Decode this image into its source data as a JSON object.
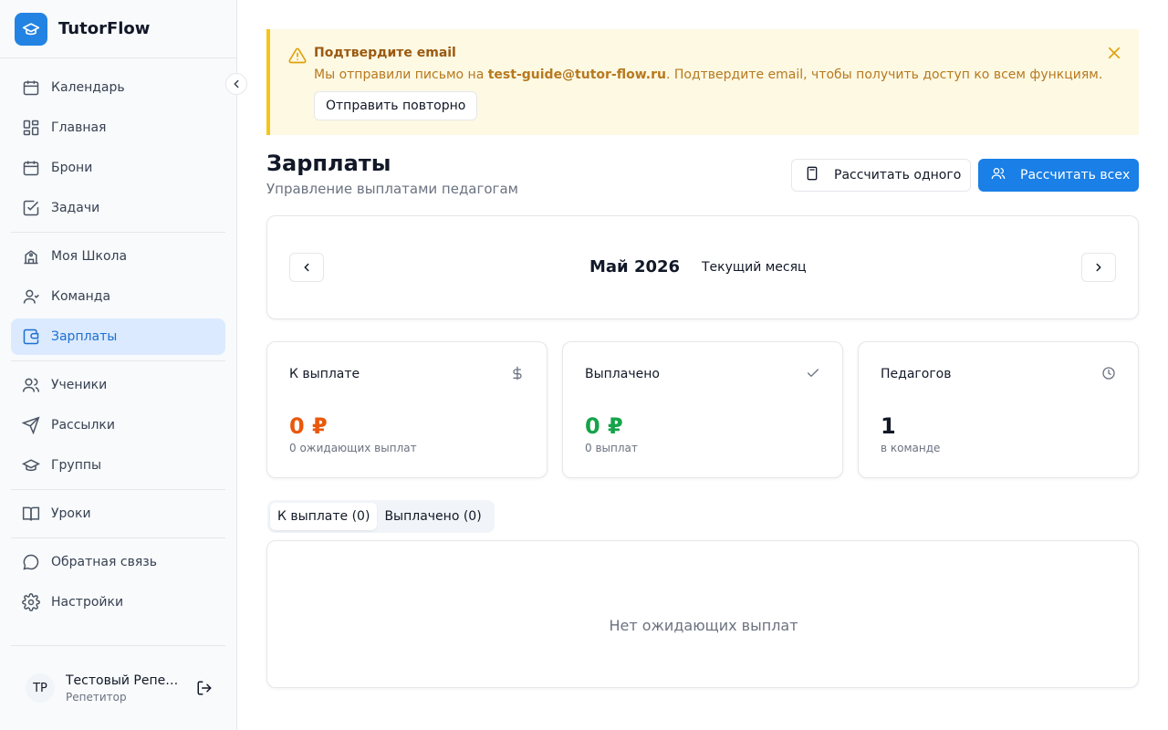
{
  "app": {
    "name": "TutorFlow",
    "logo_icon": "graduation-cap-icon",
    "accent": "#2383e2"
  },
  "sidebar": {
    "groups": [
      [
        {
          "label": "Календарь",
          "icon": "calendar-icon"
        },
        {
          "label": "Главная",
          "icon": "dashboard-icon"
        },
        {
          "label": "Брони",
          "icon": "calendar-icon"
        },
        {
          "label": "Задачи",
          "icon": "checkbox-icon"
        }
      ],
      [
        {
          "label": "Моя Школа",
          "icon": "school-icon"
        },
        {
          "label": "Команда",
          "icon": "user-icon"
        },
        {
          "label": "Зарплаты",
          "icon": "wallet-icon",
          "active": true
        }
      ],
      [
        {
          "label": "Ученики",
          "icon": "users-icon"
        },
        {
          "label": "Рассылки",
          "icon": "send-icon"
        },
        {
          "label": "Группы",
          "icon": "graduation-cap-icon"
        }
      ],
      [
        {
          "label": "Уроки",
          "icon": "book-icon"
        }
      ],
      [
        {
          "label": "Обратная связь",
          "icon": "message-icon"
        },
        {
          "label": "Настройки",
          "icon": "gear-icon"
        }
      ]
    ],
    "user": {
      "initials": "ТР",
      "name": "Тестовый Репетитор",
      "role": "Репетитор"
    }
  },
  "banner": {
    "title": "Подтвердите email",
    "text_before": "Мы отправили письмо на ",
    "email": "test-guide@tutor-flow.ru",
    "text_after": ". Подтвердите email, чтобы получить доступ ко всем функциям.",
    "resend_label": "Отправить повторно",
    "color": "#f5c518"
  },
  "page": {
    "title": "Зарплаты",
    "subtitle": "Управление выплатами педагогам",
    "calc_one_label": "Рассчитать одного",
    "calc_all_label": "Рассчитать всех"
  },
  "period": {
    "month": "Май 2026",
    "tag": "Текущий месяц"
  },
  "stats": [
    {
      "label": "К выплате",
      "value": "0 ₽",
      "note": "0 ожидающих выплат",
      "icon": "dollar-icon",
      "color": "#ea580c"
    },
    {
      "label": "Выплачено",
      "value": "0 ₽",
      "note": "0 выплат",
      "icon": "check-icon",
      "color": "#16a34a"
    },
    {
      "label": "Педагогов",
      "value": "1",
      "note": "в команде",
      "icon": "clock-icon",
      "color": "#111827"
    }
  ],
  "tabs": [
    {
      "label": "К выплате (0)",
      "active": true
    },
    {
      "label": "Выплачено (0)",
      "active": false
    }
  ],
  "empty_state": "Нет ожидающих выплат"
}
